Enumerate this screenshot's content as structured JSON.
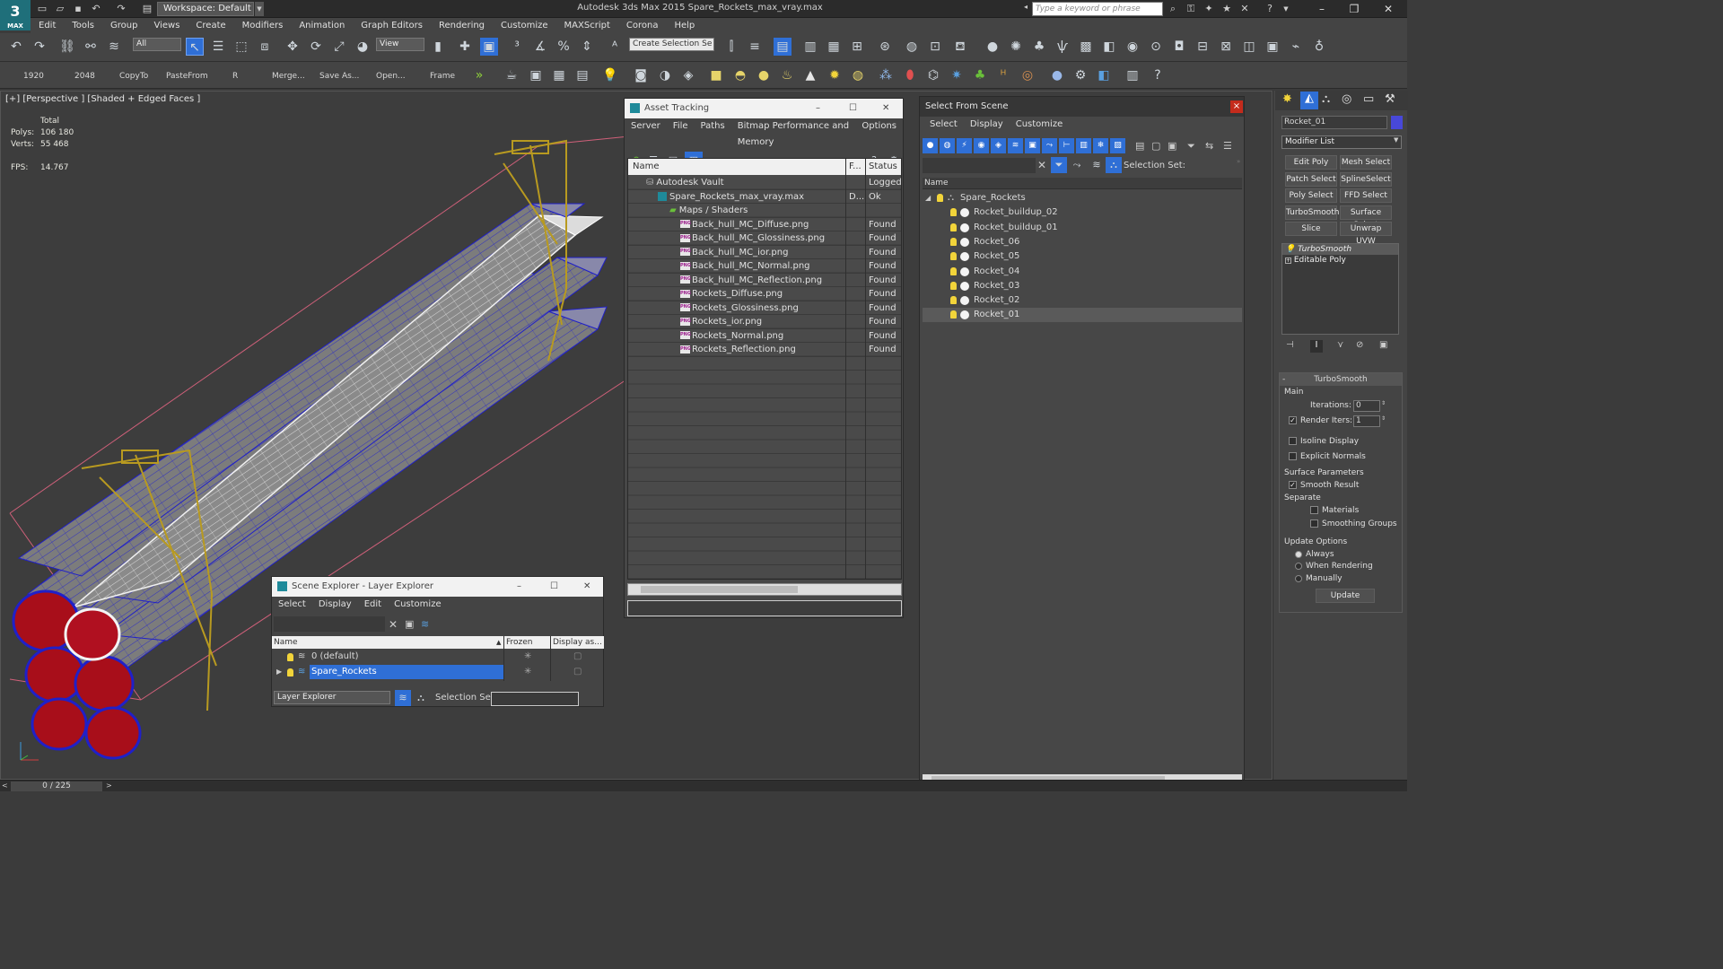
{
  "app": {
    "logo": "3",
    "logo_sub": "MAX",
    "workspace": "Workspace: Default",
    "title": "Autodesk 3ds Max  2015    Spare_Rockets_max_vray.max",
    "search_placeholder": "Type a keyword or phrase"
  },
  "menu": [
    "Edit",
    "Tools",
    "Group",
    "Views",
    "Create",
    "Modifiers",
    "Animation",
    "Graph Editors",
    "Rendering",
    "Customize",
    "MAXScript",
    "Corona",
    "Help"
  ],
  "toolbar": {
    "filter": "All",
    "refcoord": "View",
    "selset": "Create Selection Se"
  },
  "toolbar2": {
    "labels": [
      "1920",
      "2048",
      "CopyTo",
      "PasteFrom",
      "R",
      "Merge...",
      "Save As...",
      "Open...",
      "Frame"
    ]
  },
  "viewport": {
    "label": "[+] [Perspective ] [Shaded + Edged Faces ]",
    "total_label": "Total",
    "polys_label": "Polys:",
    "polys": "106 180",
    "verts_label": "Verts:",
    "verts": "55 468",
    "fps_label": "FPS:",
    "fps": "14.767"
  },
  "asset_tracking": {
    "title": "Asset Tracking",
    "menu": [
      "Server",
      "File",
      "Paths",
      "Bitmap Performance and Memory",
      "Options"
    ],
    "columns": [
      "Name",
      "F...",
      "Status"
    ],
    "rows": [
      {
        "name": "Autodesk Vault",
        "f": "",
        "status": "Logged",
        "indent": 1,
        "icon": "vault"
      },
      {
        "name": "Spare_Rockets_max_vray.max",
        "f": "D...",
        "status": "Ok",
        "indent": 2,
        "icon": "max"
      },
      {
        "name": "Maps / Shaders",
        "f": "",
        "status": "",
        "indent": 3,
        "icon": "maps"
      },
      {
        "name": "Back_hull_MC_Diffuse.png",
        "f": "",
        "status": "Found",
        "indent": 4,
        "icon": "png"
      },
      {
        "name": "Back_hull_MC_Glossiness.png",
        "f": "",
        "status": "Found",
        "indent": 4,
        "icon": "png"
      },
      {
        "name": "Back_hull_MC_ior.png",
        "f": "",
        "status": "Found",
        "indent": 4,
        "icon": "png"
      },
      {
        "name": "Back_hull_MC_Normal.png",
        "f": "",
        "status": "Found",
        "indent": 4,
        "icon": "png"
      },
      {
        "name": "Back_hull_MC_Reflection.png",
        "f": "",
        "status": "Found",
        "indent": 4,
        "icon": "png"
      },
      {
        "name": "Rockets_Diffuse.png",
        "f": "",
        "status": "Found",
        "indent": 4,
        "icon": "png"
      },
      {
        "name": "Rockets_Glossiness.png",
        "f": "",
        "status": "Found",
        "indent": 4,
        "icon": "png"
      },
      {
        "name": "Rockets_ior.png",
        "f": "",
        "status": "Found",
        "indent": 4,
        "icon": "png"
      },
      {
        "name": "Rockets_Normal.png",
        "f": "",
        "status": "Found",
        "indent": 4,
        "icon": "png"
      },
      {
        "name": "Rockets_Reflection.png",
        "f": "",
        "status": "Found",
        "indent": 4,
        "icon": "png"
      }
    ]
  },
  "scene_explorer": {
    "title": "Scene Explorer - Layer Explorer",
    "menu": [
      "Select",
      "Display",
      "Edit",
      "Customize"
    ],
    "columns": [
      "Name",
      "Frozen",
      "Display as..."
    ],
    "rows": [
      {
        "name": "0 (default)",
        "selected": false
      },
      {
        "name": "Spare_Rockets",
        "selected": true
      }
    ],
    "footer_label": "Layer Explorer",
    "selset_label": "Selection Set:"
  },
  "select_from_scene": {
    "title": "Select From Scene",
    "menu": [
      "Select",
      "Display",
      "Customize"
    ],
    "selset_label": "Selection Set:",
    "column": "Name",
    "root": "Spare_Rockets",
    "items": [
      "Rocket_buildup_02",
      "Rocket_buildup_01",
      "Rocket_06",
      "Rocket_05",
      "Rocket_04",
      "Rocket_03",
      "Rocket_02",
      "Rocket_01"
    ],
    "selected": "Rocket_01",
    "close": "×"
  },
  "command_panel": {
    "object_name": "Rocket_01",
    "object_color": "#4848d8",
    "modifier_list": "Modifier List",
    "buttons": [
      "Edit Poly",
      "Mesh Select",
      "Patch Select",
      "SplineSelect",
      "Poly Select",
      "FFD Select",
      "TurboSmooth",
      "Surface Select",
      "Slice",
      "Unwrap UVW"
    ],
    "stack": [
      "TurboSmooth",
      "Editable Poly"
    ],
    "rollout_title": "TurboSmooth",
    "main_label": "Main",
    "iterations_label": "Iterations:",
    "iterations": "0",
    "render_iters_label": "Render Iters:",
    "render_iters": "1",
    "isoline": "Isoline Display",
    "explicit_normals": "Explicit Normals",
    "surface_params": "Surface Parameters",
    "smooth_result": "Smooth Result",
    "separate": "Separate",
    "materials": "Materials",
    "smoothing_groups": "Smoothing Groups",
    "update_options": "Update Options",
    "always": "Always",
    "when_rendering": "When Rendering",
    "manually": "Manually",
    "update": "Update"
  },
  "status": {
    "frames": "0 / 225"
  },
  "colors": {
    "accent": "#1f6f7a",
    "selection": "#2f6fd6",
    "rocket_wire": "#2020c8",
    "nozzle": "#b01020",
    "truss": "#b89a20"
  }
}
